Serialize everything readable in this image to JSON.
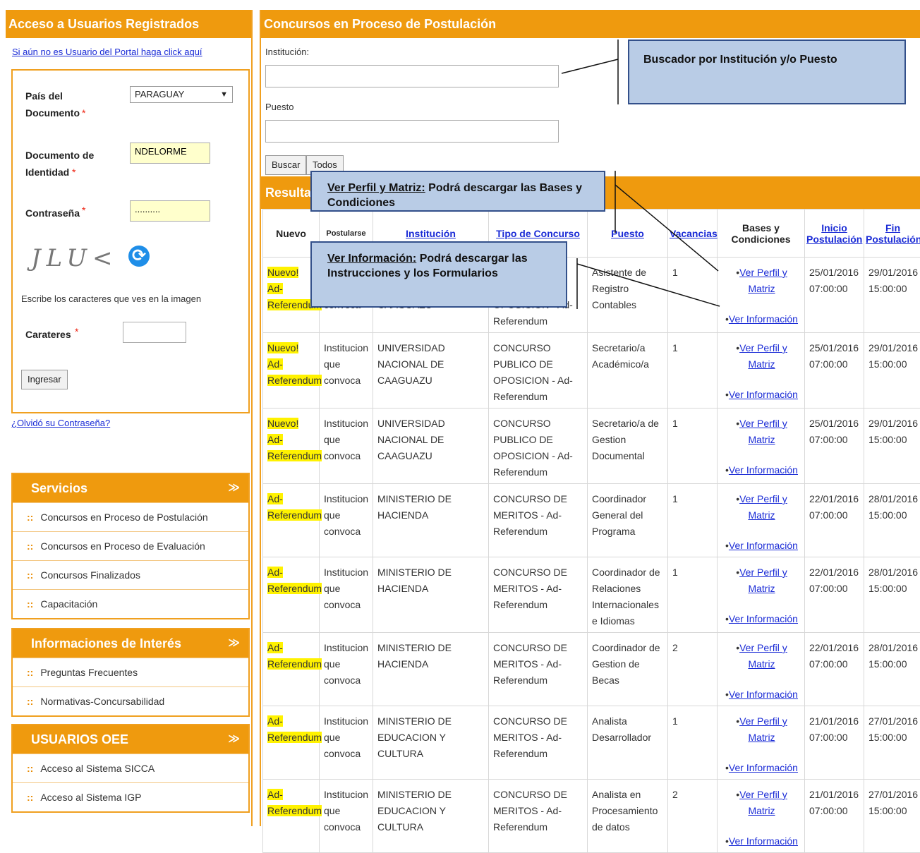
{
  "left": {
    "header": "Acceso a Usuarios Registrados",
    "register_link": "Si aún no es Usuario del Portal haga click aquí",
    "login": {
      "country_label": "País del Documento",
      "country_value": "PARAGUAY",
      "document_label": "Documento de Identidad",
      "document_value": "NDELORME",
      "password_label": "Contraseña",
      "password_value": "..........",
      "captcha_text": "JLU<",
      "captcha_help": "Escribe los caracteres que ves en la imagen",
      "captcha_label": "Carateres",
      "captcha_value": "",
      "submit_label": "Ingresar",
      "required_mark": "*"
    },
    "forgot_link": "¿Olvidó su Contraseña?",
    "panels": [
      {
        "title": "Servicios",
        "items": [
          "Concursos en Proceso de Postulación",
          "Concursos en Proceso de Evaluación",
          "Concursos Finalizados",
          "Capacitación"
        ]
      },
      {
        "title": "Informaciones de Interés",
        "items": [
          "Preguntas Frecuentes",
          "Normativas-Concursabilidad"
        ]
      },
      {
        "title": "USUARIOS OEE",
        "items": [
          "Acceso al Sistema SICCA",
          "Acceso al Sistema IGP"
        ]
      }
    ]
  },
  "right": {
    "header": "Concursos en Proceso de Postulación",
    "institution_label": "Institución:",
    "institution_value": "",
    "position_label": "Puesto",
    "position_value": "",
    "search_button": "Buscar",
    "all_button": "Todos",
    "results_header": "Resultados",
    "columns": [
      "Nuevo",
      "Postularse",
      "Institución",
      "Tipo de Concurso",
      "Puesto",
      "Vacancias",
      "Bases y Condiciones",
      "Inicio Postulación",
      "Fin Postulación"
    ],
    "link_profile": "Ver Perfil y Matriz",
    "link_info": "Ver Información",
    "rows": [
      {
        "nuevo": "Nuevo! Ad-Referendum",
        "postularse": "Institucion que convoca",
        "institucion": "UNIVERSIDAD NACIONAL DE CAAGUAZU",
        "tipo": "CONCURSO PUBLICO DE OPOSICION - Ad-Referendum",
        "puesto": "Asistente de Registro Contables",
        "vacancias": "1",
        "inicio": "25/01/2016 07:00:00",
        "fin": "29/01/2016 15:00:00"
      },
      {
        "nuevo": "Nuevo! Ad-Referendum",
        "postularse": "Institucion que convoca",
        "institucion": "UNIVERSIDAD NACIONAL DE CAAGUAZU",
        "tipo": "CONCURSO PUBLICO DE OPOSICION - Ad-Referendum",
        "puesto": "Secretario/a Académico/a",
        "vacancias": "1",
        "inicio": "25/01/2016 07:00:00",
        "fin": "29/01/2016 15:00:00"
      },
      {
        "nuevo": "Nuevo! Ad-Referendum",
        "postularse": "Institucion que convoca",
        "institucion": "UNIVERSIDAD NACIONAL DE CAAGUAZU",
        "tipo": "CONCURSO PUBLICO DE OPOSICION - Ad-Referendum",
        "puesto": "Secretario/a de Gestion Documental",
        "vacancias": "1",
        "inicio": "25/01/2016 07:00:00",
        "fin": "29/01/2016 15:00:00"
      },
      {
        "nuevo": "Ad-Referendum",
        "postularse": "Institucion que convoca",
        "institucion": "MINISTERIO DE HACIENDA",
        "tipo": "CONCURSO DE MERITOS - Ad-Referendum",
        "puesto": "Coordinador General del Programa",
        "vacancias": "1",
        "inicio": "22/01/2016 07:00:00",
        "fin": "28/01/2016 15:00:00"
      },
      {
        "nuevo": "Ad-Referendum",
        "postularse": "Institucion que convoca",
        "institucion": "MINISTERIO DE HACIENDA",
        "tipo": "CONCURSO DE MERITOS - Ad-Referendum",
        "puesto": "Coordinador de Relaciones Internacionales e Idiomas",
        "vacancias": "1",
        "inicio": "22/01/2016 07:00:00",
        "fin": "28/01/2016 15:00:00"
      },
      {
        "nuevo": "Ad-Referendum",
        "postularse": "Institucion que convoca",
        "institucion": "MINISTERIO DE HACIENDA",
        "tipo": "CONCURSO DE MERITOS - Ad-Referendum",
        "puesto": "Coordinador de Gestion de Becas",
        "vacancias": "2",
        "inicio": "22/01/2016 07:00:00",
        "fin": "28/01/2016 15:00:00"
      },
      {
        "nuevo": "Ad-Referendum",
        "postularse": "Institucion que convoca",
        "institucion": "MINISTERIO DE EDUCACION Y CULTURA",
        "tipo": "CONCURSO DE MERITOS - Ad-Referendum",
        "puesto": "Analista Desarrollador",
        "vacancias": "1",
        "inicio": "21/01/2016 07:00:00",
        "fin": "27/01/2016 15:00:00"
      },
      {
        "nuevo": "Ad-Referendum",
        "postularse": "Institucion que convoca",
        "institucion": "MINISTERIO DE EDUCACION Y CULTURA",
        "tipo": "CONCURSO DE MERITOS - Ad-Referendum",
        "puesto": "Analista en Procesamiento de datos",
        "vacancias": "2",
        "inicio": "21/01/2016 07:00:00",
        "fin": "27/01/2016 15:00:00"
      }
    ]
  },
  "callouts": {
    "search": "Buscador por Institución y/o Puesto",
    "profile_title": "Ver Perfil y Matriz:",
    "profile_text": " Podrá descargar las Bases y Condiciones",
    "info_title": "Ver Información:",
    "info_text": " Podrá descargar las Instrucciones y los Formularios"
  },
  "colors": {
    "accent": "#ef9a0e",
    "highlight": "#fff200",
    "link": "#1a2bd6",
    "callout_bg": "#b9cce6"
  },
  "icons": {
    "refresh": "refresh-icon",
    "chevron": "chevron-up-icon",
    "bullet": "bullet-icon"
  }
}
